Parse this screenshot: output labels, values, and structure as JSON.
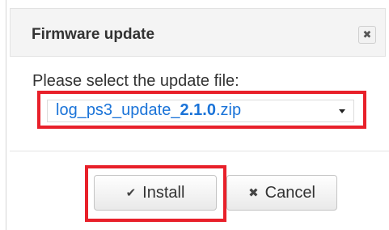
{
  "dialog": {
    "title": "Firmware update",
    "close_symbol": "✖",
    "prompt": "Please select the update file:",
    "file_select": {
      "value_prefix": "log_ps3_update_",
      "value_version": "2.1.0",
      "value_suffix": ".zip"
    },
    "buttons": {
      "install_icon": "✔",
      "install_label": "Install",
      "cancel_icon": "✖",
      "cancel_label": "Cancel"
    }
  },
  "colors": {
    "highlight": "#e8202a",
    "file_link": "#1a73d8"
  },
  "icons": {
    "close": "close-icon",
    "install": "checkmark-icon",
    "cancel": "x-icon",
    "select": "chevron-down-icon"
  }
}
